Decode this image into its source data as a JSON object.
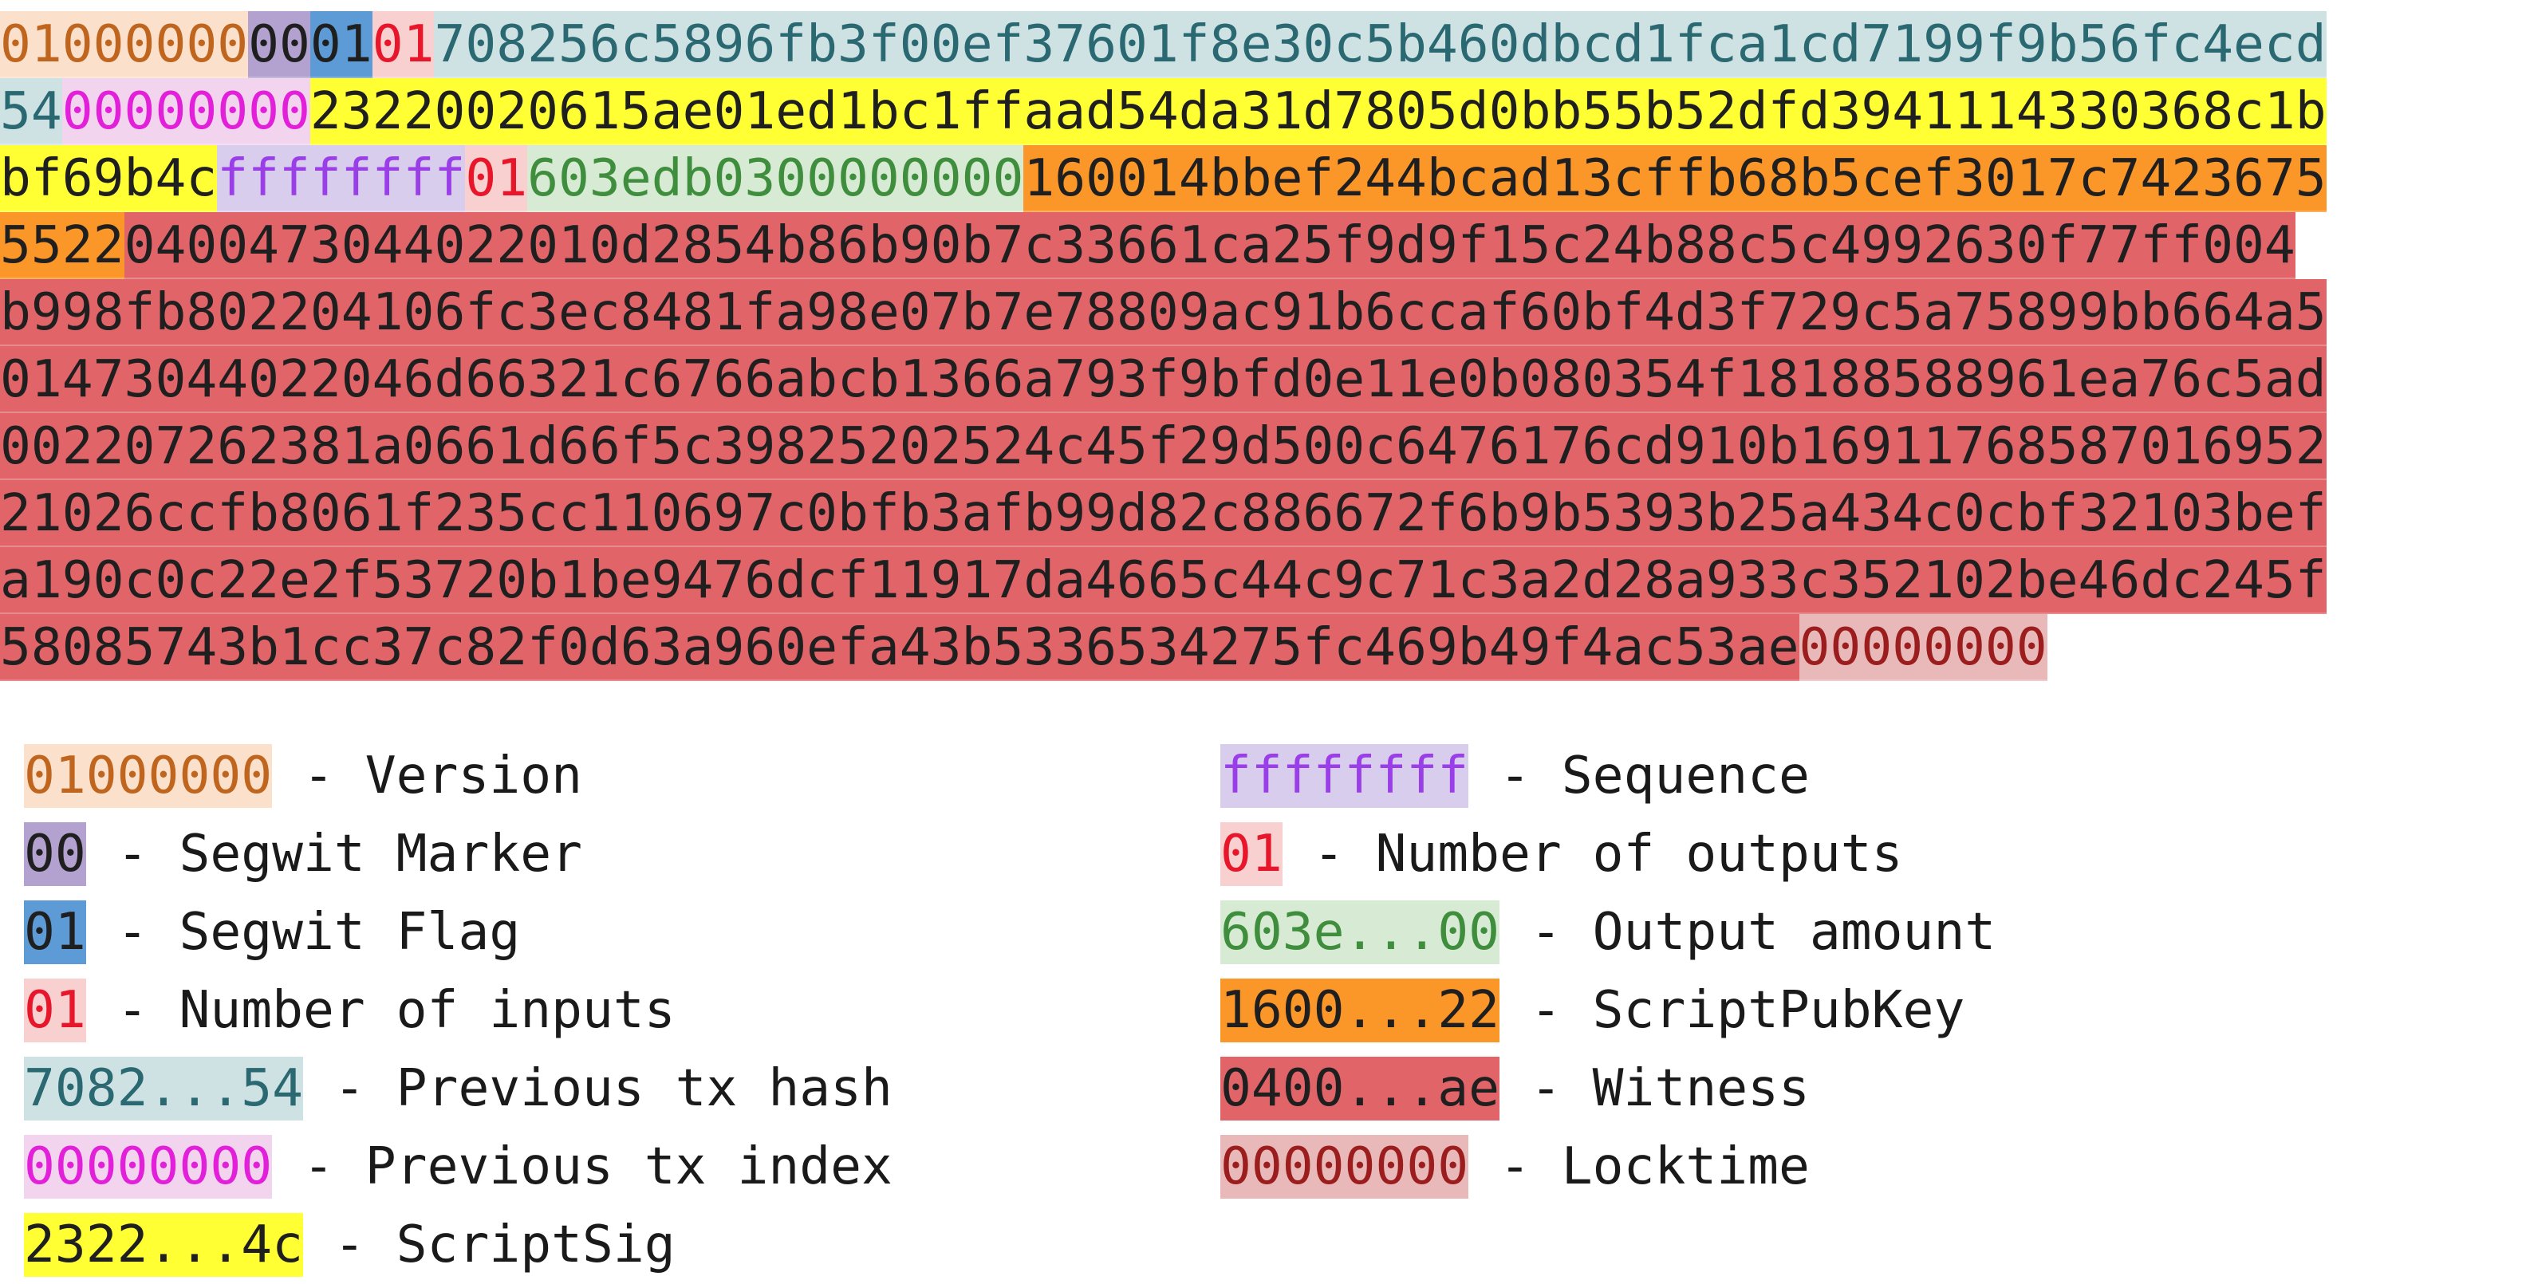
{
  "segments": [
    {
      "line": 0,
      "text": "01000000",
      "key": "version"
    },
    {
      "line": 0,
      "text": "00",
      "key": "marker"
    },
    {
      "line": 0,
      "text": "01",
      "key": "flag"
    },
    {
      "line": 0,
      "text": "01",
      "key": "inputs"
    },
    {
      "line": 0,
      "text": "708256c5896fb3f00ef37601f8e30c5b460dbcd1fca1cd7199f9b56fc4ecd",
      "key": "prevhash"
    },
    {
      "line": 1,
      "text": "54",
      "key": "prevhash"
    },
    {
      "line": 1,
      "text": "00000000",
      "key": "previndex"
    },
    {
      "line": 1,
      "text": "23220020615ae01ed1bc1ffaad54da31d7805d0bb55b52dfd3941114330368c1b",
      "key": "scriptsig"
    },
    {
      "line": 2,
      "text": "bf69b4c",
      "key": "scriptsig"
    },
    {
      "line": 2,
      "text": "ffffffff",
      "key": "sequence"
    },
    {
      "line": 2,
      "text": "01",
      "key": "outputs"
    },
    {
      "line": 2,
      "text": "603edb0300000000",
      "key": "amount"
    },
    {
      "line": 2,
      "text": "160014bbef244bcad13cffb68b5cef3017c7423675",
      "key": "scriptpubkey"
    },
    {
      "line": 3,
      "text": "5522",
      "key": "scriptpubkey"
    },
    {
      "line": 3,
      "text": "0400473044022010d2854b86b90b7c33661ca25f9d9f15c24b88c5c4992630f77ff004",
      "key": "witness"
    },
    {
      "line": 4,
      "text": "b998fb802204106fc3ec8481fa98e07b7e78809ac91b6ccaf60bf4d3f729c5a75899bb664a5",
      "key": "witness"
    },
    {
      "line": 5,
      "text": "01473044022046d66321c6766abcb1366a793f9bfd0e11e0b080354f18188588961ea76c5ad",
      "key": "witness"
    },
    {
      "line": 6,
      "text": "002207262381a0661d66f5c39825202524c45f29d500c6476176cd910b16911768587016952",
      "key": "witness"
    },
    {
      "line": 7,
      "text": "21026ccfb8061f235cc110697c0bfb3afb99d82c886672f6b9b5393b25a434c0cbf32103bef",
      "key": "witness"
    },
    {
      "line": 8,
      "text": "a190c0c22e2f53720b1be9476dcf11917da4665c44c9c71c3a2d28a933c352102be46dc245f",
      "key": "witness"
    },
    {
      "line": 9,
      "text": "58085743b1cc37c82f0d63a960efa43b5336534275fc469b49f4ac53ae",
      "key": "witness"
    },
    {
      "line": 9,
      "text": "00000000",
      "key": "locktime"
    }
  ],
  "styles": {
    "version": {
      "bg": "#fbe0cc",
      "fg": "#c0651e"
    },
    "marker": {
      "bg": "#b3a2cf",
      "fg": "#1f1f1f"
    },
    "flag": {
      "bg": "#5c9bd5",
      "fg": "#1f1f1f"
    },
    "inputs": {
      "bg": "#f8d0d0",
      "fg": "#e8162b"
    },
    "prevhash": {
      "bg": "#cfe2e3",
      "fg": "#2a6872"
    },
    "previndex": {
      "bg": "#f3d4ee",
      "fg": "#e21fd9"
    },
    "scriptsig": {
      "bg": "#ffff33",
      "fg": "#1f1f1f"
    },
    "sequence": {
      "bg": "#d9cdee",
      "fg": "#9a3ee8"
    },
    "outputs": {
      "bg": "#f8d0d0",
      "fg": "#e8162b"
    },
    "amount": {
      "bg": "#d7ead3",
      "fg": "#3f8e3d"
    },
    "scriptpubkey": {
      "bg": "#fb9629",
      "fg": "#1f1f1f"
    },
    "witness": {
      "bg": "#e06468",
      "fg": "#1f1f1f"
    },
    "locktime": {
      "bg": "#e9b9b9",
      "fg": "#9b1d1d"
    }
  },
  "legend": {
    "left": [
      {
        "key": "version",
        "sample": "01000000",
        "label": " - Version"
      },
      {
        "key": "marker",
        "sample": "00",
        "label": " - Segwit Marker"
      },
      {
        "key": "flag",
        "sample": "01",
        "label": " - Segwit Flag"
      },
      {
        "key": "inputs",
        "sample": "01",
        "label": " - Number of inputs"
      },
      {
        "key": "prevhash",
        "sample": "7082...54",
        "label": " - Previous tx hash"
      },
      {
        "key": "previndex",
        "sample": "00000000",
        "label": " - Previous tx index"
      },
      {
        "key": "scriptsig",
        "sample": "2322...4c",
        "label": " - ScriptSig"
      }
    ],
    "right": [
      {
        "key": "sequence",
        "sample": "ffffffff",
        "label": " - Sequence"
      },
      {
        "key": "outputs",
        "sample": "01",
        "label": " - Number of outputs"
      },
      {
        "key": "amount",
        "sample": "603e...00",
        "label": " - Output amount"
      },
      {
        "key": "scriptpubkey",
        "sample": "1600...22",
        "label": " - ScriptPubKey"
      },
      {
        "key": "witness",
        "sample": "0400...ae",
        "label": " - Witness"
      },
      {
        "key": "locktime",
        "sample": "00000000",
        "label": " - Locktime"
      }
    ]
  }
}
